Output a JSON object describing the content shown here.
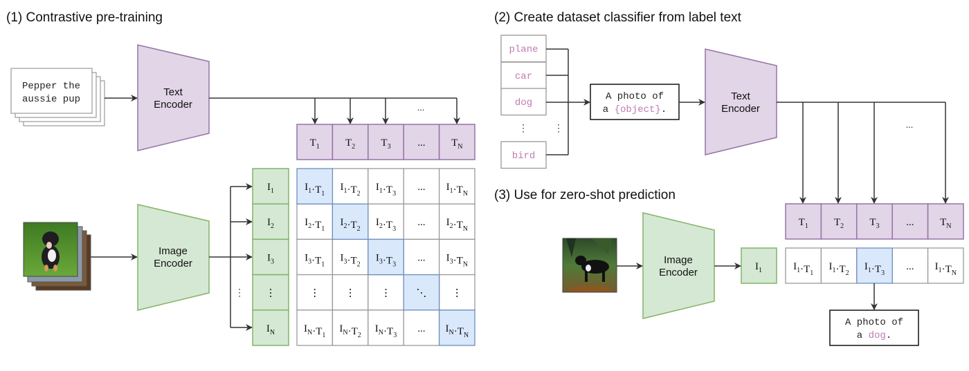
{
  "colors": {
    "text_enc_fill": "#e1d5e7",
    "text_enc_stroke": "#9673a6",
    "img_enc_fill": "#d5e8d4",
    "img_enc_stroke": "#82b366",
    "highlight_fill": "#dae8fc",
    "highlight_stroke": "#6c8ebf",
    "cell_stroke": "#999999",
    "label_pink": "#c07bb2"
  },
  "panel1": {
    "title": "(1) Contrastive pre-training",
    "text_input": [
      "Pepper the",
      "aussie pup"
    ],
    "text_encoder": [
      "Text",
      "Encoder"
    ],
    "image_encoder": [
      "Image",
      "Encoder"
    ],
    "image_desc": "Photo of puppy on grass (stacked images)",
    "t_cells": [
      {
        "base": "T",
        "sub": "1"
      },
      {
        "base": "T",
        "sub": "2"
      },
      {
        "base": "T",
        "sub": "3"
      },
      {
        "base": "...",
        "sub": ""
      },
      {
        "base": "T",
        "sub": "N"
      }
    ],
    "i_cells": [
      {
        "base": "I",
        "sub": "1"
      },
      {
        "base": "I",
        "sub": "2"
      },
      {
        "base": "I",
        "sub": "3"
      },
      {
        "base": "⋮",
        "sub": ""
      },
      {
        "base": "I",
        "sub": "N"
      }
    ],
    "arrow_ellipsis": "...",
    "branch_ellipsis": "⋮",
    "matrix": [
      [
        "I1·T1",
        "I1·T2",
        "I1·T3",
        "...",
        "I1·TN"
      ],
      [
        "I2·T1",
        "I2·T2",
        "I2·T3",
        "...",
        "I2·TN"
      ],
      [
        "I3·T1",
        "I3·T2",
        "I3·T3",
        "...",
        "I3·TN"
      ],
      [
        "⋮",
        "⋮",
        "⋮",
        "⋱",
        "⋮"
      ],
      [
        "IN·T1",
        "IN·T2",
        "IN·T3",
        "...",
        "IN·TN"
      ]
    ],
    "matrix_highlight": [
      [
        0,
        0
      ],
      [
        1,
        1
      ],
      [
        2,
        2
      ],
      [
        3,
        3
      ],
      [
        4,
        4
      ]
    ]
  },
  "panel2": {
    "title": "(2) Create dataset classifier from label text",
    "labels": [
      "plane",
      "car",
      "dog",
      "bird"
    ],
    "label_ellipsis": "⋮",
    "prompt_line1": "A photo of",
    "prompt_line2_prefix": "a ",
    "prompt_line2_var": "{object}",
    "prompt_line2_suffix": ".",
    "text_encoder": [
      "Text",
      "Encoder"
    ],
    "arrow_ellipsis": "...",
    "t_cells": [
      {
        "base": "T",
        "sub": "1"
      },
      {
        "base": "T",
        "sub": "2"
      },
      {
        "base": "T",
        "sub": "3"
      },
      {
        "base": "...",
        "sub": ""
      },
      {
        "base": "T",
        "sub": "N"
      }
    ]
  },
  "panel3": {
    "title": "(3) Use for zero-shot prediction",
    "image_desc": "Photo of black dog in field",
    "image_encoder": [
      "Image",
      "Encoder"
    ],
    "i_cell": {
      "base": "I",
      "sub": "1"
    },
    "scores": [
      "I1·T1",
      "I1·T2",
      "I1·T3",
      "...",
      "I1·TN"
    ],
    "highlight_index": 2,
    "result_line1": "A photo of",
    "result_line2_prefix": "a ",
    "result_line2_var": "dog",
    "result_line2_suffix": "."
  }
}
